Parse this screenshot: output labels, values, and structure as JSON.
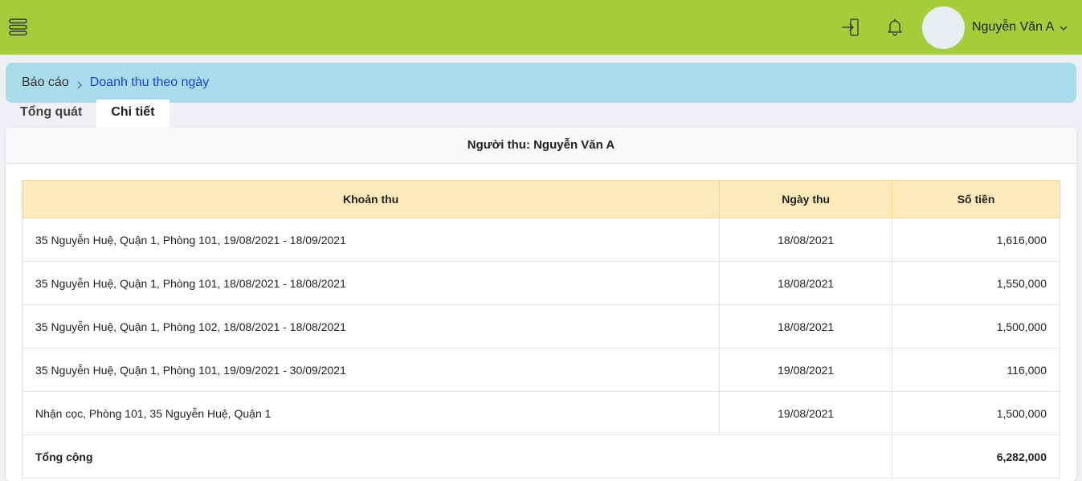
{
  "header": {
    "user_name": "Nguyễn Văn A",
    "icons": [
      "menu-icon",
      "logout-icon",
      "bell-icon",
      "chevron-down-icon"
    ],
    "bar_color": "#a4cd39"
  },
  "breadcrumb": {
    "root": "Báo cáo",
    "current": "Doanh thu theo ngày"
  },
  "tabs": [
    {
      "label": "Tổng quát",
      "active": false
    },
    {
      "label": "Chi tiết",
      "active": true
    }
  ],
  "card": {
    "title": "Người thu: Nguyễn Văn A"
  },
  "table": {
    "headers": {
      "item": "Khoản thu",
      "date": "Ngày thu",
      "amount": "Số tiền"
    },
    "rows": [
      {
        "item": "35 Nguyễn Huệ, Quận 1, Phòng 101, 19/08/2021 - 18/09/2021",
        "date": "18/08/2021",
        "amount": "1,616,000"
      },
      {
        "item": "35 Nguyễn Huệ, Quận 1, Phòng 101, 18/08/2021 - 18/08/2021",
        "date": "18/08/2021",
        "amount": "1,550,000"
      },
      {
        "item": "35 Nguyễn Huệ, Quận 1, Phòng 102, 18/08/2021 - 18/08/2021",
        "date": "18/08/2021",
        "amount": "1,500,000"
      },
      {
        "item": "35 Nguyễn Huệ, Quận 1, Phòng 101, 19/09/2021 - 30/09/2021",
        "date": "19/08/2021",
        "amount": "116,000"
      },
      {
        "item": "Nhận cọc, Phòng 101, 35 Nguyễn Huệ, Quận 1",
        "date": "19/08/2021",
        "amount": "1,500,000"
      }
    ],
    "total_label": "Tổng cộng",
    "total_amount": "6,282,000"
  }
}
